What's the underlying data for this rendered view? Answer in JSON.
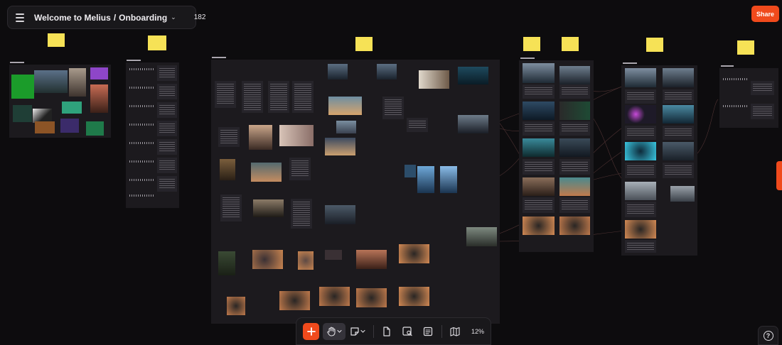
{
  "header": {
    "workspace": "Welcome to Melius",
    "separator": "/",
    "project": "Onboarding",
    "credits": "182"
  },
  "share_label": "Share",
  "toolbar": {
    "zoom": "12%"
  },
  "help_label": "?",
  "colors": {
    "accent": "#f04a1c",
    "canvas": "#0d0c0e",
    "board": "#1c1a1e",
    "sticky": "#f6e256",
    "credits_icon": "#2d4fd6"
  },
  "icons": [
    "menu-icon",
    "chevron-down-icon",
    "credits-icon",
    "plus-icon",
    "hand-icon",
    "sticky-note-icon",
    "document-icon",
    "image-search-icon",
    "list-icon",
    "map-icon",
    "help-icon"
  ]
}
